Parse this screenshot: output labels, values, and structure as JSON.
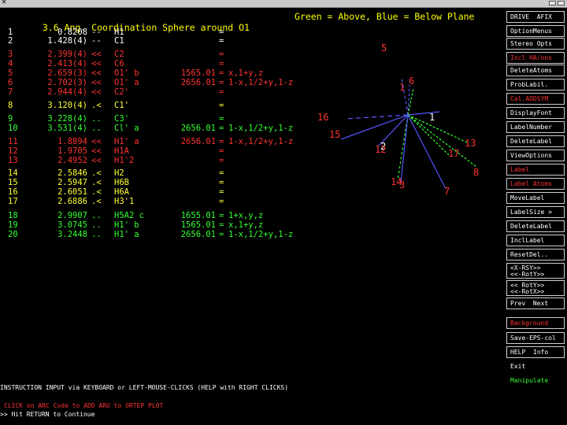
{
  "window": {
    "close_glyph": "✕"
  },
  "header": {
    "title": "3.6 Ang. Coordination Sphere around O1",
    "legend": "Green = Above, Blue = Below Plane"
  },
  "table": {
    "rows": [
      {
        "num": "1",
        "dist": "0.8208",
        "sym": "--",
        "atom": "H1",
        "code": "",
        "eq": "=",
        "op": "",
        "color": "#ffffff"
      },
      {
        "num": "2",
        "dist": "1.428(4)",
        "sym": "--",
        "atom": "C1",
        "code": "",
        "eq": "=",
        "op": "",
        "color": "#ffffff"
      },
      {
        "num": "3",
        "dist": "2.399(4)",
        "sym": "<<",
        "atom": "C2",
        "code": "",
        "eq": "=",
        "op": "",
        "color": "#ff3333"
      },
      {
        "num": "4",
        "dist": "2.413(4)",
        "sym": "<<",
        "atom": "C6",
        "code": "",
        "eq": "=",
        "op": "",
        "color": "#ff3333"
      },
      {
        "num": "5",
        "dist": "2.659(3)",
        "sym": "<<",
        "atom": "O1' b",
        "code": "1565.01",
        "eq": "=",
        "op": "x,1+y,z",
        "color": "#ff3333"
      },
      {
        "num": "6",
        "dist": "2.702(3)",
        "sym": "<<",
        "atom": "O1' a",
        "code": "2656.01",
        "eq": "=",
        "op": "1-x,1/2+y,1-z",
        "color": "#ff3333"
      },
      {
        "num": "7",
        "dist": "2.944(4)",
        "sym": "<<",
        "atom": "C2'",
        "code": "",
        "eq": "=",
        "op": "",
        "color": "#ff3333"
      },
      {
        "num": "8",
        "dist": "3.120(4)",
        "sym": ".<",
        "atom": "C1'",
        "code": "",
        "eq": "=",
        "op": "",
        "color": "#ffff33"
      },
      {
        "num": "9",
        "dist": "3.228(4)",
        "sym": "..",
        "atom": "C3'",
        "code": "",
        "eq": "=",
        "op": "",
        "color": "#33ff33"
      },
      {
        "num": "10",
        "dist": "3.531(4)",
        "sym": "..",
        "atom": "Cl' a",
        "code": "2656.01",
        "eq": "=",
        "op": "1-x,1/2+y,1-z",
        "color": "#33ff33"
      },
      {
        "num": "11",
        "dist": "1.8894",
        "sym": "<<",
        "atom": "H1' a",
        "code": "2656.01",
        "eq": "=",
        "op": "1-x,1/2+y,1-z",
        "color": "#ff3333"
      },
      {
        "num": "12",
        "dist": "1.9705",
        "sym": "<<",
        "atom": "H1A",
        "code": "",
        "eq": "=",
        "op": "",
        "color": "#ff3333"
      },
      {
        "num": "13",
        "dist": "2.4952",
        "sym": "<<",
        "atom": "H1'2",
        "code": "",
        "eq": "=",
        "op": "",
        "color": "#ff3333"
      },
      {
        "num": "14",
        "dist": "2.5846",
        "sym": ".<",
        "atom": "H2",
        "code": "",
        "eq": "=",
        "op": "",
        "color": "#ffff33"
      },
      {
        "num": "15",
        "dist": "2.5947",
        "sym": ".<",
        "atom": "H6B",
        "code": "",
        "eq": "=",
        "op": "",
        "color": "#ffff33"
      },
      {
        "num": "16",
        "dist": "2.6051",
        "sym": ".<",
        "atom": "H6A",
        "code": "",
        "eq": "=",
        "op": "",
        "color": "#ffff33"
      },
      {
        "num": "17",
        "dist": "2.6886",
        "sym": ".<",
        "atom": "H3'1",
        "code": "",
        "eq": "=",
        "op": "",
        "color": "#ffff33"
      },
      {
        "num": "18",
        "dist": "2.9907",
        "sym": "..",
        "atom": "H5A2 c",
        "code": "1655.01",
        "eq": "=",
        "op": "1+x,y,z",
        "color": "#33ff33"
      },
      {
        "num": "19",
        "dist": "3.0745",
        "sym": "..",
        "atom": "H1' b",
        "code": "1565.01",
        "eq": "=",
        "op": "x,1+y,z",
        "color": "#33ff33"
      },
      {
        "num": "20",
        "dist": "3.2448",
        "sym": "..",
        "atom": "H1' a",
        "code": "2656.01",
        "eq": "=",
        "op": "1-x,1/2+y,1-z",
        "color": "#33ff33"
      }
    ]
  },
  "plot": {
    "labels": [
      {
        "text": "5",
        "color": "#ff3333"
      },
      {
        "text": "1",
        "color": "#ff3333"
      },
      {
        "text": "6",
        "color": "#ff3333"
      },
      {
        "text": "1",
        "color": "#ffffff"
      },
      {
        "text": "16",
        "color": "#ff3333"
      },
      {
        "text": "15",
        "color": "#ff3333"
      },
      {
        "text": "2",
        "color": "#ffffff"
      },
      {
        "text": "12",
        "color": "#ff3333"
      },
      {
        "text": "13",
        "color": "#ff3333"
      },
      {
        "text": "17",
        "color": "#ff3333"
      },
      {
        "text": "8",
        "color": "#ff3333"
      },
      {
        "text": "14",
        "color": "#ff3333"
      },
      {
        "text": "3",
        "color": "#ff3333"
      },
      {
        "text": "7",
        "color": "#ff3333"
      }
    ]
  },
  "menu": {
    "items": [
      {
        "label": "DRIVE  AFIX",
        "color": "#ffffff"
      },
      {
        "label": "OptionMenus",
        "color": "#ffffff"
      },
      {
        "label": "Stereo Opts",
        "color": "#ffffff"
      },
      {
        "label": "Incl HA/ons",
        "color": "#ff3333"
      },
      {
        "label": "DeleteAtoms",
        "color": "#ffffff"
      },
      {
        "label": "ProbLabil.",
        "color": "#ffffff"
      },
      {
        "label": "Cal.ADDSYM",
        "color": "#ff3333"
      },
      {
        "label": "DisplayFont",
        "color": "#ffffff"
      },
      {
        "label": "LabelNumber",
        "color": "#ffffff"
      },
      {
        "label": "DeleteLabel",
        "color": "#ffffff"
      },
      {
        "label": "ViewOptions",
        "color": "#ffffff"
      },
      {
        "label": "Label",
        "color": "#ff3333"
      },
      {
        "label": "Label Atoms",
        "color": "#ff3333"
      },
      {
        "label": "MoveLabel",
        "color": "#ffffff"
      },
      {
        "label": "LabelSize >",
        "color": "#ffffff"
      },
      {
        "label": "DeleteLabel",
        "color": "#ffffff"
      },
      {
        "label": "InclLabel",
        "color": "#ffffff"
      },
      {
        "label": "ResetDel..",
        "color": "#ffffff"
      },
      {
        "label": "<X-RSY>>\n<<-RotY>>",
        "color": "#ffffff"
      },
      {
        "label": "<< RotY>>\n<<-RotX>>",
        "color": "#ffffff"
      },
      {
        "label": "Prev  Next",
        "color": "#ffffff"
      },
      {
        "label": "Background",
        "color": "#ff3333"
      },
      {
        "label": "Save-EPS-col",
        "color": "#ffffff"
      },
      {
        "label": "HELP  Info",
        "color": "#ffffff"
      },
      {
        "label": "Exit",
        "color": "#ffffff"
      },
      {
        "label": "Manipulate",
        "color": "#33ff33"
      }
    ]
  },
  "footer": {
    "line1": "INSTRUCTION INPUT via KEYBOARD or LEFT-MOUSE-CLICKS (HELP with RIGHT CLICKS)",
    "line2": "CLICK on ARC Code to ADD ARU to ORTEP PLOT",
    "line3": ">> Hit RETURN to Continue"
  }
}
